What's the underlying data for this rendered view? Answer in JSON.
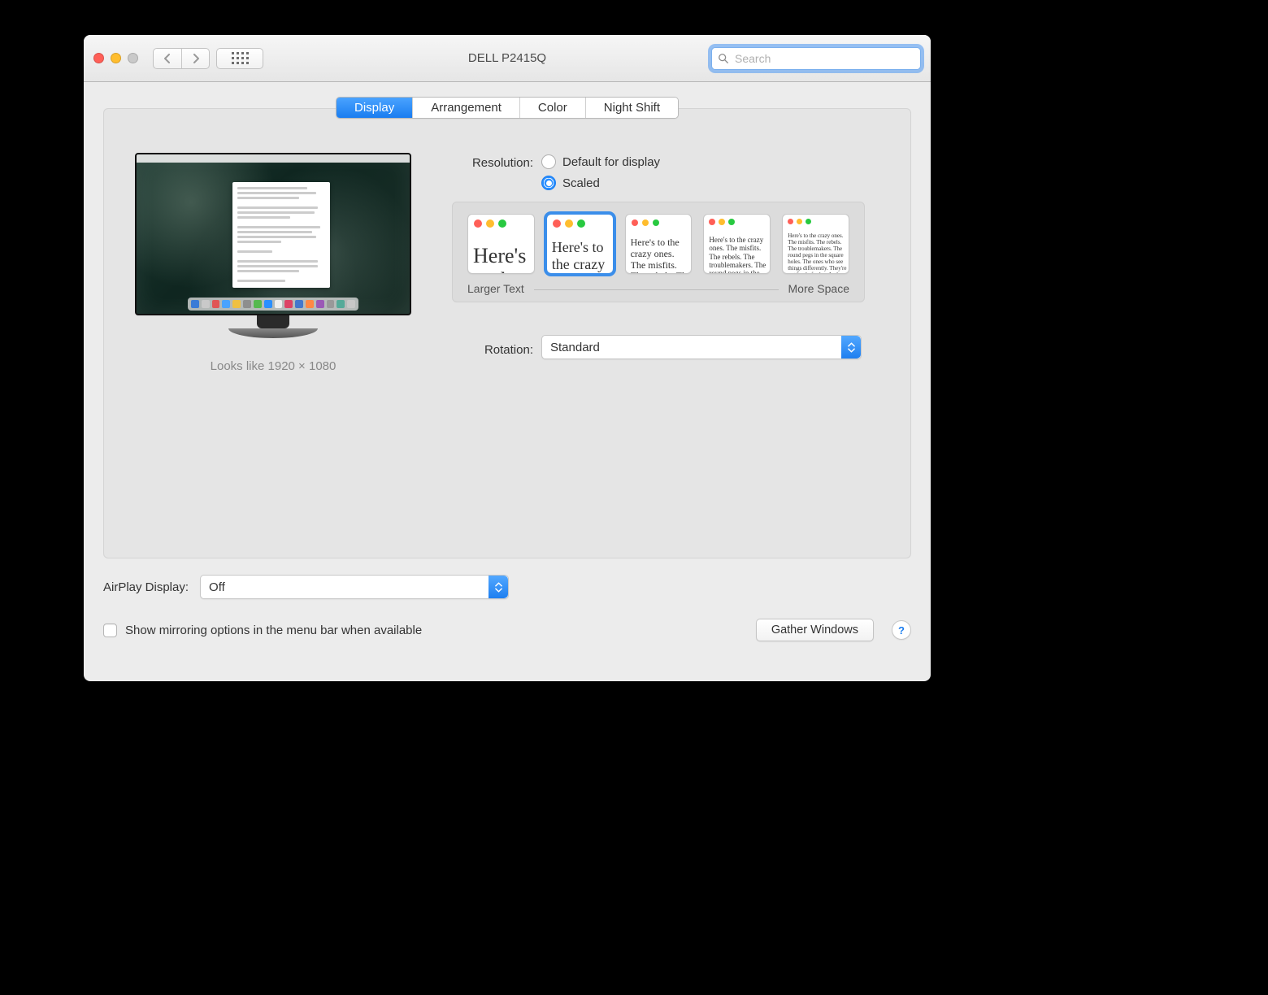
{
  "window": {
    "title": "DELL P2415Q",
    "search_placeholder": "Search"
  },
  "tabs": {
    "display": "Display",
    "arrangement": "Arrangement",
    "color": "Color",
    "night_shift": "Night Shift",
    "active": "display"
  },
  "preview": {
    "looks_like": "Looks like 1920 × 1080"
  },
  "resolution": {
    "label": "Resolution:",
    "opt_default": "Default for display",
    "opt_scaled": "Scaled",
    "selected": "scaled",
    "scale_larger": "Larger Text",
    "scale_more": "More Space",
    "sample_text": "Here's to the crazy ones. The misfits. The rebels. The troublemakers. The round pegs in the square holes. The ones who see things differently. They're not fond of rules. And they have no respect for the status quo. You can quote them, disagree with them, glorify or vilify them. About the only thing you can't do is ignore them. Because they change things."
  },
  "rotation": {
    "label": "Rotation:",
    "value": "Standard"
  },
  "airplay": {
    "label": "AirPlay Display:",
    "value": "Off"
  },
  "footer": {
    "mirroring": "Show mirroring options in the menu bar when available",
    "gather": "Gather Windows",
    "help": "?"
  }
}
